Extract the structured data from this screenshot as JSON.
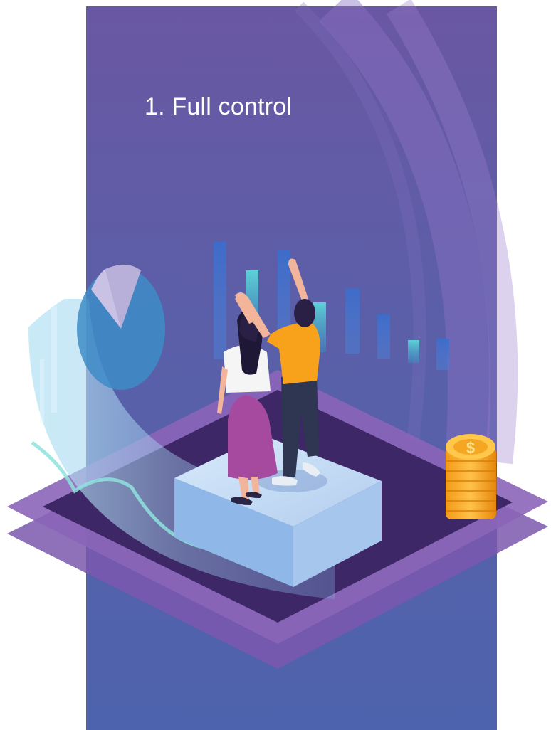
{
  "slide": {
    "title": "1. Full control"
  },
  "illustration": {
    "coin_symbol": "$"
  },
  "colors": {
    "panel_top": "#6a57a3",
    "panel_bottom": "#4e63ad",
    "platform": "#3d2766",
    "platform_edge": "#8b65b8",
    "pedestal": "#b9d3ef",
    "coin": "#f5a623",
    "shirt_man": "#f8a21b",
    "skirt_woman": "#a64a9f"
  }
}
